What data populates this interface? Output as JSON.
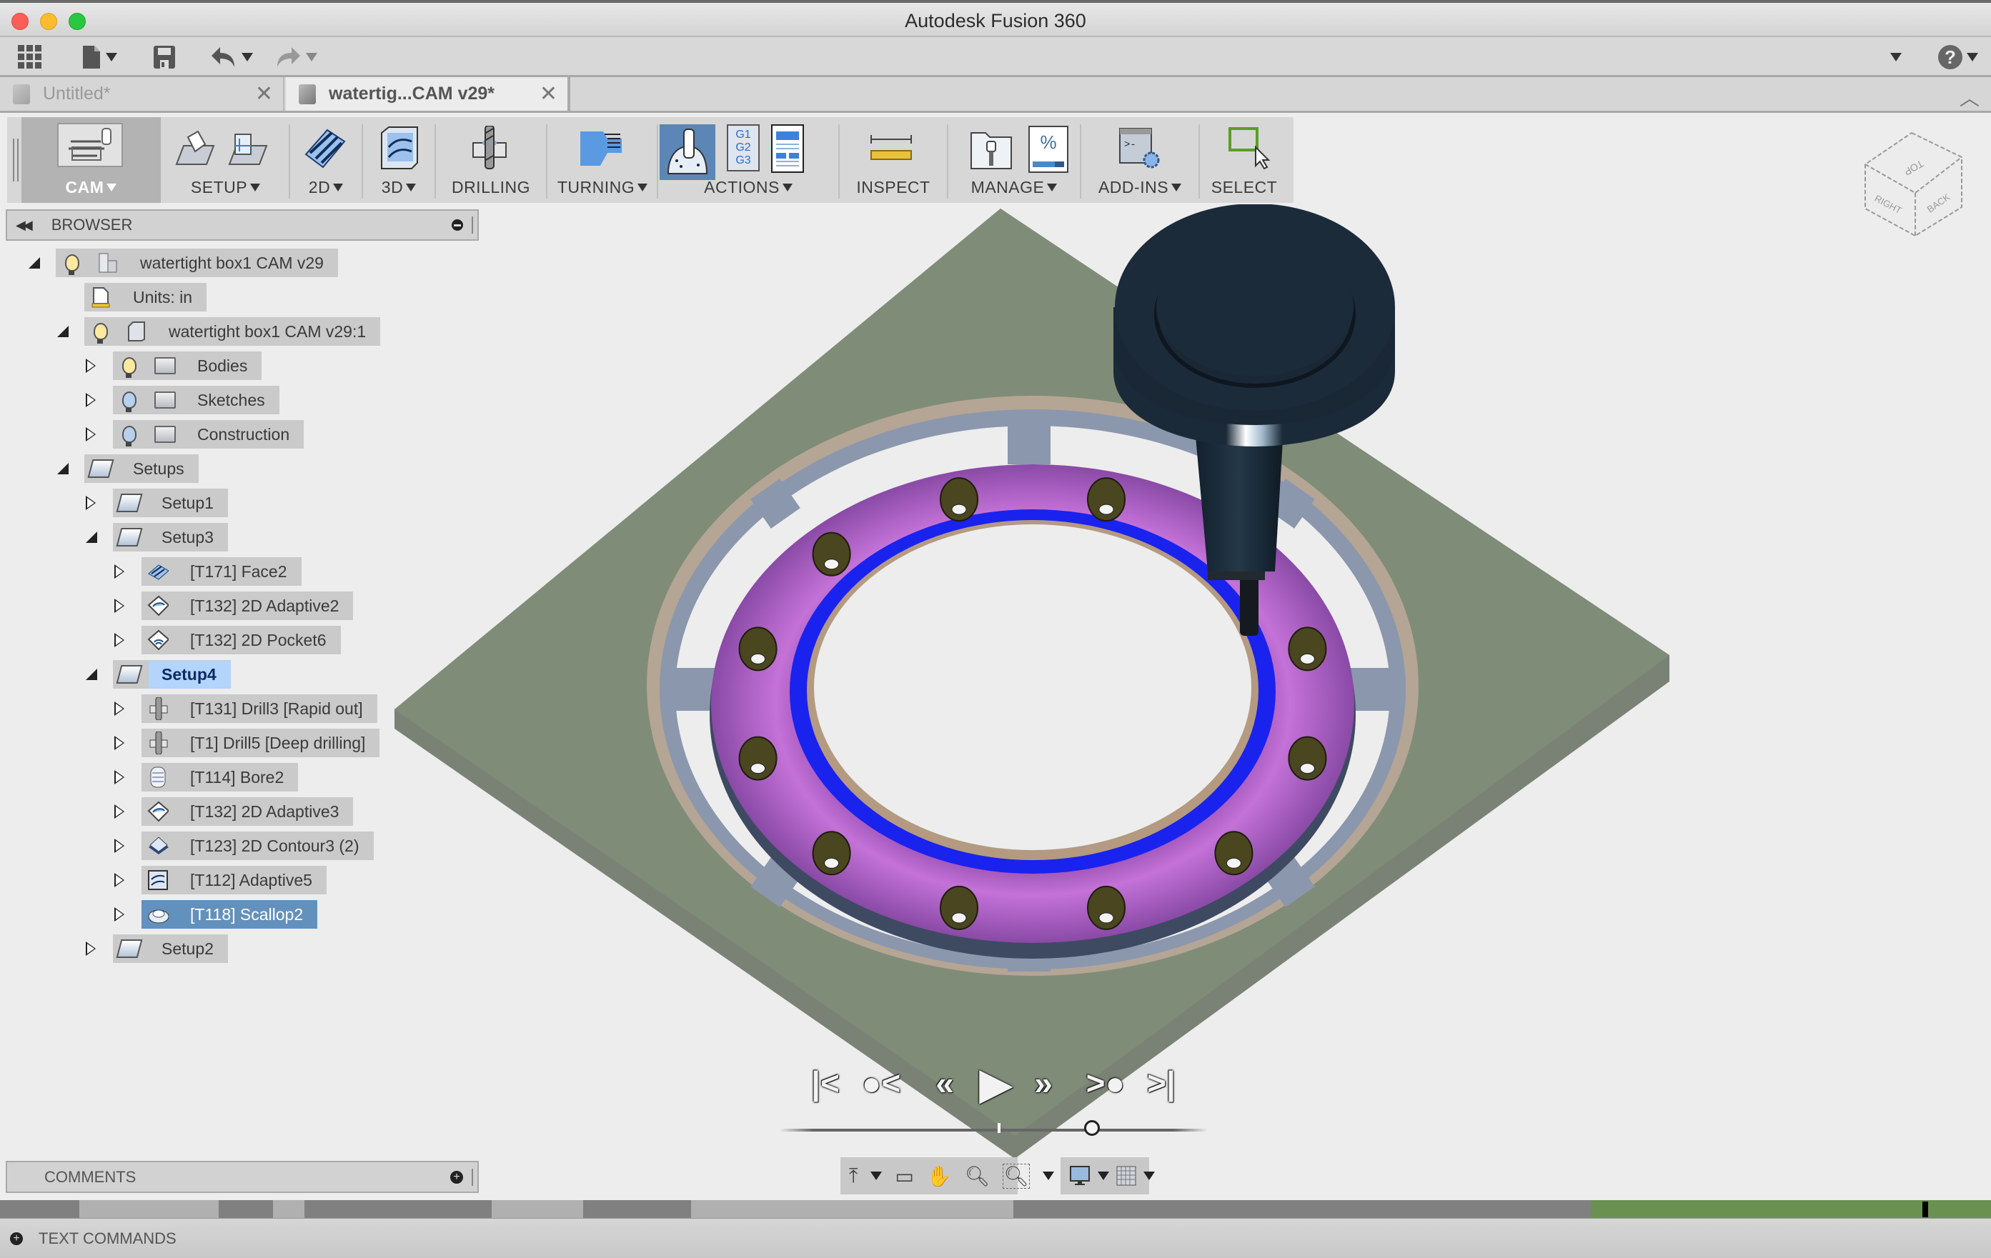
{
  "window": {
    "title": "Autodesk Fusion 360",
    "traffic_lights": {
      "close": "#fc5f57",
      "minimize": "#fdbc2e",
      "zoom": "#28c840"
    }
  },
  "quick_access": {
    "icons": [
      "apps-grid-icon",
      "file-icon",
      "save-icon",
      "undo-icon",
      "redo-icon",
      "user-dropdown-icon",
      "help-icon"
    ]
  },
  "tabs": [
    {
      "label": "Untitled*",
      "active": false
    },
    {
      "label": "watertig...CAM v29*",
      "active": true
    }
  ],
  "ribbon": {
    "workspace": "CAM",
    "groups": [
      {
        "label": "SETUP",
        "dropdown": true
      },
      {
        "label": "2D",
        "dropdown": true
      },
      {
        "label": "3D",
        "dropdown": true
      },
      {
        "label": "DRILLING",
        "dropdown": false
      },
      {
        "label": "TURNING",
        "dropdown": true
      },
      {
        "label": "ACTIONS",
        "dropdown": true
      },
      {
        "label": "INSPECT",
        "dropdown": false
      },
      {
        "label": "MANAGE",
        "dropdown": true
      },
      {
        "label": "ADD-INS",
        "dropdown": true
      },
      {
        "label": "SELECT",
        "dropdown": false
      }
    ],
    "gcode_icon_text": [
      "G1",
      "G2",
      "G3"
    ],
    "manage_percent_text": "%",
    "addins_prompt_text": ">-"
  },
  "browser": {
    "title": "BROWSER",
    "tree": [
      {
        "label": "watertight box1 CAM v29",
        "level": 0,
        "expander": "open",
        "icons": [
          "lightbulb-on-icon",
          "component-icon"
        ]
      },
      {
        "label": "Units: in",
        "level": 1,
        "expander": "none",
        "icons": [
          "units-document-icon"
        ]
      },
      {
        "label": "watertight box1 CAM v29:1",
        "level": 1,
        "expander": "open",
        "icons": [
          "lightbulb-on-icon",
          "body-icon"
        ]
      },
      {
        "label": "Bodies",
        "level": 2,
        "expander": "closed",
        "icons": [
          "lightbulb-on-icon",
          "folder-icon"
        ]
      },
      {
        "label": "Sketches",
        "level": 2,
        "expander": "closed",
        "icons": [
          "lightbulb-off-icon",
          "folder-icon"
        ]
      },
      {
        "label": "Construction",
        "level": 2,
        "expander": "closed",
        "icons": [
          "lightbulb-off-icon",
          "folder-icon"
        ]
      },
      {
        "label": "Setups",
        "level": 1,
        "expander": "open",
        "icons": [
          "setups-icon"
        ]
      },
      {
        "label": "Setup1",
        "level": 2,
        "expander": "closed",
        "icons": [
          "setup-icon"
        ]
      },
      {
        "label": "Setup3",
        "level": 2,
        "expander": "open",
        "icons": [
          "setup-icon"
        ]
      },
      {
        "label": "[T171] Face2",
        "level": 3,
        "expander": "closed",
        "icons": [
          "face-op-icon"
        ]
      },
      {
        "label": "[T132] 2D Adaptive2",
        "level": 3,
        "expander": "closed",
        "icons": [
          "adaptive-2d-op-icon"
        ]
      },
      {
        "label": "[T132] 2D Pocket6",
        "level": 3,
        "expander": "closed",
        "icons": [
          "pocket-2d-op-icon"
        ]
      },
      {
        "label": "Setup4",
        "level": 2,
        "expander": "open",
        "icons": [
          "setup-icon"
        ],
        "state": "active"
      },
      {
        "label": "[T131] Drill3 [Rapid out]",
        "level": 3,
        "expander": "closed",
        "icons": [
          "drill-op-icon"
        ]
      },
      {
        "label": "[T1] Drill5 [Deep drilling]",
        "level": 3,
        "expander": "closed",
        "icons": [
          "drill-op-icon"
        ]
      },
      {
        "label": "[T114] Bore2",
        "level": 3,
        "expander": "closed",
        "icons": [
          "bore-op-icon"
        ]
      },
      {
        "label": "[T132] 2D Adaptive3",
        "level": 3,
        "expander": "closed",
        "icons": [
          "adaptive-2d-op-icon"
        ]
      },
      {
        "label": "[T123] 2D Contour3 (2)",
        "level": 3,
        "expander": "closed",
        "icons": [
          "contour-2d-op-icon"
        ]
      },
      {
        "label": "[T112] Adaptive5",
        "level": 3,
        "expander": "closed",
        "icons": [
          "adaptive-3d-op-icon"
        ]
      },
      {
        "label": "[T118] Scallop2",
        "level": 3,
        "expander": "closed",
        "icons": [
          "scallop-op-icon"
        ],
        "state": "selected"
      },
      {
        "label": "Setup2",
        "level": 2,
        "expander": "closed",
        "icons": [
          "setup-icon"
        ]
      }
    ]
  },
  "viewcube": {
    "faces": [
      "TOP",
      "RIGHT",
      "BACK"
    ]
  },
  "simulation": {
    "controls": [
      "go-to-start",
      "previous-operation",
      "step-back",
      "play",
      "step-forward",
      "next-operation",
      "go-to-end"
    ],
    "progress": 0.73,
    "marker": 0.51
  },
  "navbar": {
    "icons": [
      "orbit-icon",
      "look-at-icon",
      "pan-icon",
      "zoom-icon",
      "zoom-window-icon",
      "display-settings-icon",
      "grid-icon"
    ]
  },
  "comments": {
    "title": "COMMENTS"
  },
  "timeline": {
    "segments": [
      {
        "kind": "dark",
        "width": 0.04
      },
      {
        "kind": "light",
        "width": 0.07
      },
      {
        "kind": "dark",
        "width": 0.027
      },
      {
        "kind": "light",
        "width": 0.016
      },
      {
        "kind": "dark",
        "width": 0.094
      },
      {
        "kind": "light",
        "width": 0.046
      },
      {
        "kind": "dark",
        "width": 0.054
      },
      {
        "kind": "light",
        "width": 0.162
      },
      {
        "kind": "dark",
        "width": 0.29
      },
      {
        "kind": "green",
        "width": 0.201
      }
    ],
    "colors": {
      "dark": "#808080",
      "light": "#b0b0b0",
      "green": "#6b9150"
    }
  },
  "text_commands": {
    "title": "TEXT COMMANDS"
  },
  "model_colors": {
    "plate": "#7f8d78",
    "plate_edge": "#7a8275",
    "ring_toolpath": "#b25fc8",
    "toolpath_blue": "#1a22ee",
    "tool": "#1c2b3a"
  }
}
